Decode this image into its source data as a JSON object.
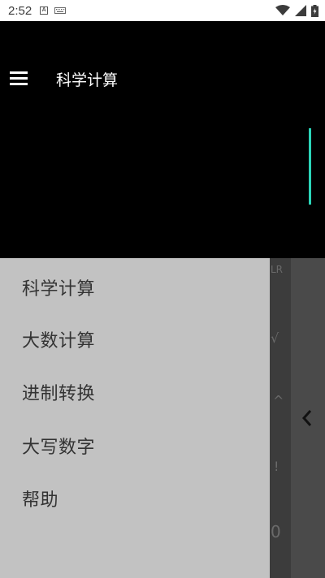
{
  "status_bar": {
    "time": "2:52",
    "notification_icon": "A"
  },
  "app_bar": {
    "title": "科学计算"
  },
  "drawer": {
    "items": [
      {
        "label": "科学计算"
      },
      {
        "label": "大数计算"
      },
      {
        "label": "进制转换"
      },
      {
        "label": "大写数字"
      },
      {
        "label": "帮助"
      }
    ]
  },
  "keypad_ghost": {
    "k1": "LR",
    "k2": "√",
    "k3": "^",
    "k4": "!",
    "k5": "0"
  },
  "colors": {
    "accent": "#2bd4b8",
    "drawer_bg": "#c2c2c2",
    "header_bg": "#000000"
  }
}
